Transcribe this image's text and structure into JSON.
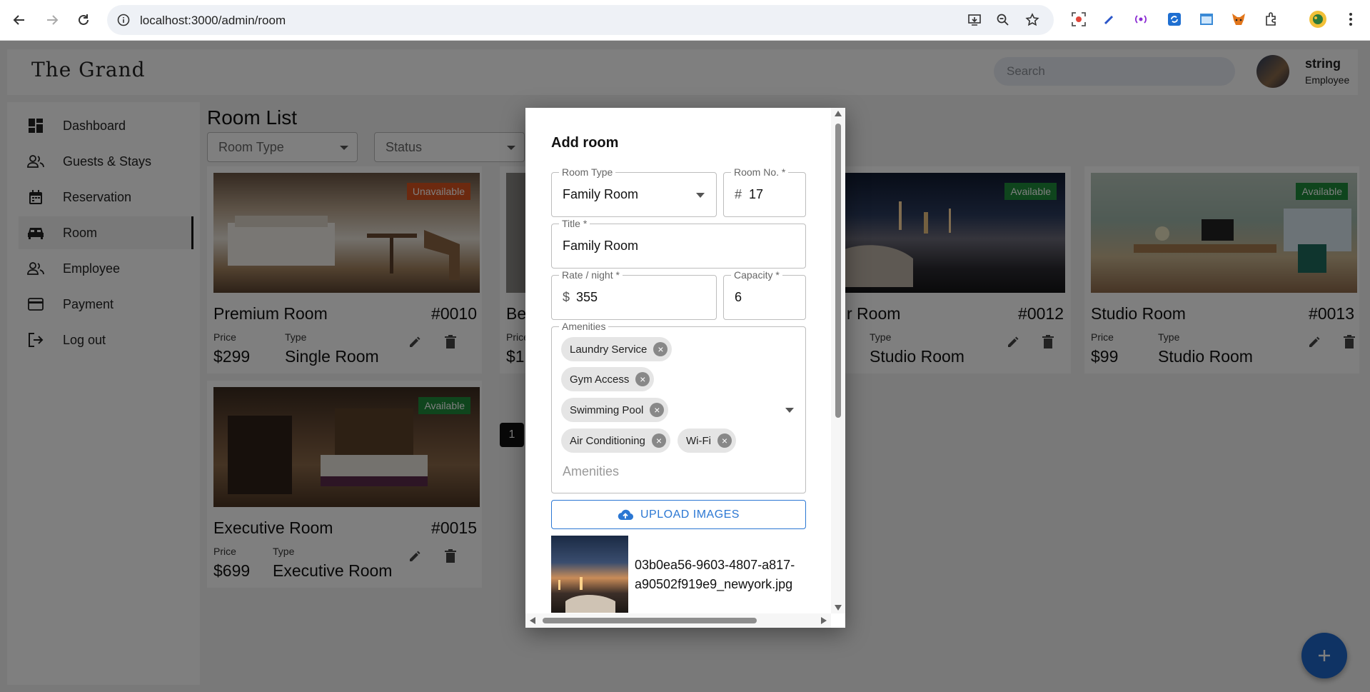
{
  "browser": {
    "url": "localhost:3000/admin/room"
  },
  "header": {
    "logo": "The Grand",
    "search_placeholder": "Search",
    "user_name": "string",
    "user_role": "Employee"
  },
  "sidebar": {
    "items": [
      {
        "label": "Dashboard",
        "icon": "dashboard-icon"
      },
      {
        "label": "Guests & Stays",
        "icon": "people-icon"
      },
      {
        "label": "Reservation",
        "icon": "calendar-icon"
      },
      {
        "label": "Room",
        "icon": "bed-icon",
        "active": true
      },
      {
        "label": "Employee",
        "icon": "people-icon"
      },
      {
        "label": "Payment",
        "icon": "credit-card-icon"
      },
      {
        "label": "Log out",
        "icon": "logout-icon"
      }
    ]
  },
  "main": {
    "title": "Room List",
    "filters": {
      "room_type": "Room Type",
      "status": "Status"
    },
    "price_label": "Price",
    "type_label": "Type",
    "cards": [
      {
        "name": "Premium Room",
        "number": "#0010",
        "price": "$299",
        "type": "Single Room",
        "status": "Unavailable"
      },
      {
        "name": "Be",
        "number": "",
        "price": "$1",
        "type": "",
        "status": ""
      },
      {
        "name": "r Room",
        "number": "#0012",
        "price": "",
        "type": "Studio Room",
        "status": "Available"
      },
      {
        "name": "Studio Room",
        "number": "#0013",
        "price": "$99",
        "type": "Studio Room",
        "status": "Available"
      },
      {
        "name": "Executive Room",
        "number": "#0015",
        "price": "$699",
        "type": "Executive Room",
        "status": "Available"
      }
    ],
    "partial_price_label": "Price",
    "page": "1"
  },
  "colors": {
    "unavailable": "#d9531e",
    "available": "#1f8a3b",
    "accent": "#2b77d3"
  },
  "modal": {
    "title": "Add room",
    "room_type": {
      "label": "Room Type",
      "value": "Family Room"
    },
    "room_no": {
      "label": "Room No. *",
      "prefix": "#",
      "value": "17"
    },
    "title_field": {
      "label": "Title *",
      "value": "Family Room"
    },
    "rate": {
      "label": "Rate / night *",
      "prefix": "$",
      "value": "355"
    },
    "capacity": {
      "label": "Capacity *",
      "value": "6"
    },
    "amenities": {
      "label": "Amenities",
      "placeholder": "Amenities",
      "chips": [
        "Laundry Service",
        "Gym Access",
        "Swimming Pool",
        "Air Conditioning",
        "Wi-Fi"
      ]
    },
    "upload_label": "UPLOAD IMAGES",
    "image_filename": "03b0ea56-9603-4807-a817-a90502f919e9_newyork.jpg"
  }
}
